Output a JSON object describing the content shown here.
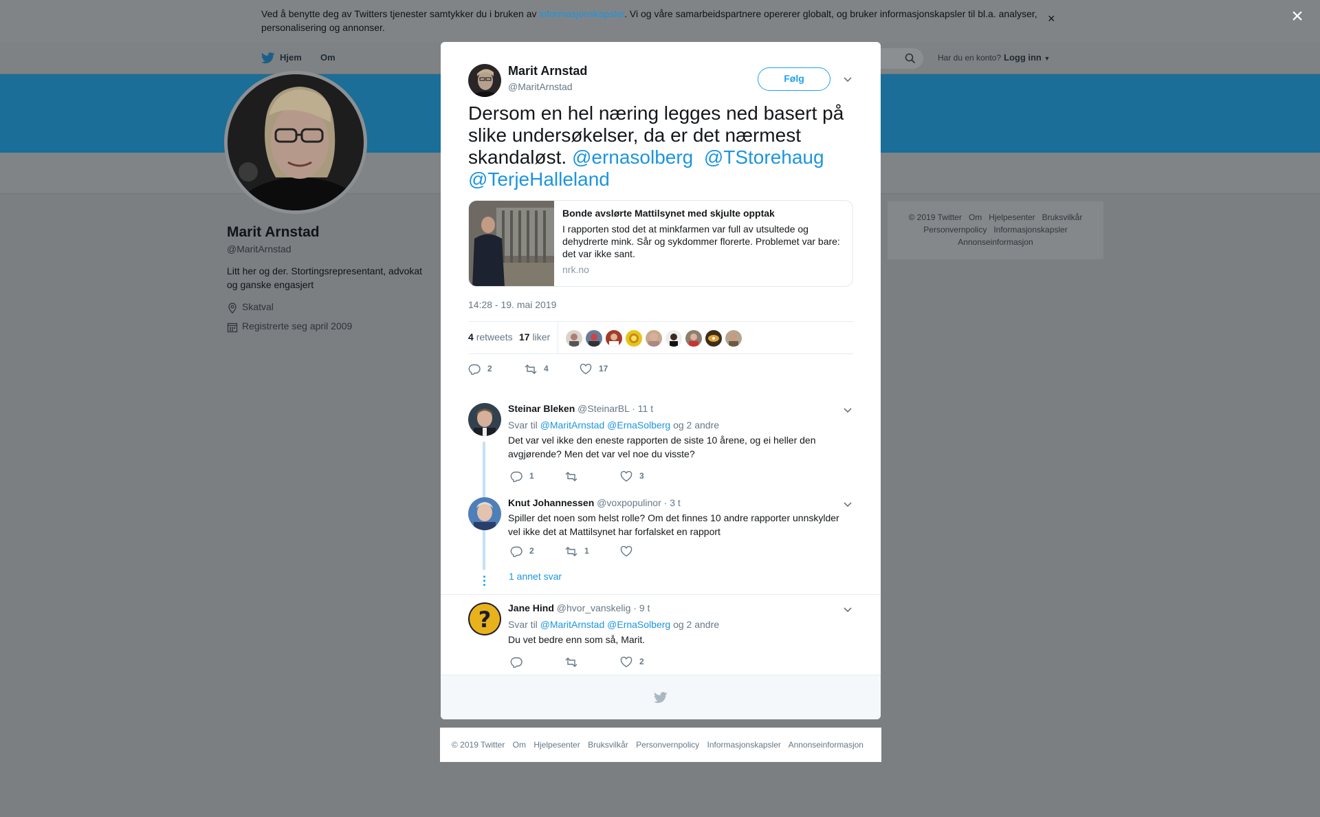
{
  "cookie": {
    "text_before": "Ved å benytte deg av Twitters tjenester samtykker du i bruken av ",
    "link": "informasjonskapsler",
    "text_after": ". Vi og våre samarbeidspartnere opererer globalt, og bruker informasjonskapsler til bl.a. analyser, personalisering og annonser.",
    "close_icon": "×"
  },
  "overlay_close_icon": "×",
  "nav": {
    "home": "Hjem",
    "about": "Om",
    "account_question": "Har du en konto?",
    "login": "Logg inn"
  },
  "profile": {
    "name": "Marit Arnstad",
    "handle": "@MaritArnstad",
    "bio": "Litt her og der. Stortingsrepresentant, advokat og ganske engasjert",
    "location": "Skatval",
    "joined": "Registrerte seg april 2009"
  },
  "side_footer": {
    "row1": [
      "© 2019 Twitter",
      "Om",
      "Hjelpesenter",
      "Bruksvilkår"
    ],
    "row2": [
      "Personvernpolicy",
      "Informasjonskapsler"
    ],
    "row3": [
      "Annonseinformasjon"
    ]
  },
  "tweet": {
    "author_name": "Marit Arnstad",
    "author_handle": "@MaritArnstad",
    "follow_label": "Følg",
    "text_line": "Dersom en hel næring legges ned basert på slike undersøkelser, da er det nærmest skandaløst. ",
    "mention1": "@ernasolberg",
    "mention2": "@TStorehaug",
    "mention3": "@TerjeHalleland",
    "card_title": "Bonde avslørte Mattilsynet med skjulte opptak",
    "card_desc": "I rapporten stod det at minkfarmen var full av utsultede og dehydrerte mink. Sår og sykdommer florerte. Problemet var bare: det var ikke sant.",
    "card_domain": "nrk.no",
    "time": "14:28 - 19. mai 2019",
    "retweets_count": "4",
    "retweets_label": "retweets",
    "likes_count": "17",
    "likes_label": "liker",
    "actions": {
      "replies": "2",
      "retweets": "4",
      "likes": "17"
    }
  },
  "replies": [
    {
      "name": "Steinar Bleken",
      "handle": "@SteinarBL",
      "time": "· 11 t",
      "reply_to_prefix": "Svar til",
      "reply_to_mentions": "@MaritArnstad @ErnaSolberg",
      "reply_to_suffix": "og 2 andre",
      "text": "Det var vel ikke den eneste rapporten de siste 10 årene, og ei heller den avgjørende? Men det var vel noe du visste?",
      "replies": "1",
      "retweets": "",
      "likes": "3"
    },
    {
      "name": "Knut Johannessen",
      "handle": "@voxpopulinor",
      "time": "· 3 t",
      "text": "Spiller det noen som helst rolle? Om det finnes 10 andre rapporter unnskylder vel ikke det at Mattilsynet har forfalsket en rapport",
      "replies": "2",
      "retweets": "1",
      "likes": ""
    },
    {
      "name": "Jane Hind",
      "handle": "@hvor_vanskelig",
      "time": "· 9 t",
      "reply_to_prefix": "Svar til",
      "reply_to_mentions": "@MaritArnstad @ErnaSolberg",
      "reply_to_suffix": "og 2 andre",
      "text": "Du vet bedre enn som så, Marit.",
      "replies": "",
      "retweets": "",
      "likes": "2"
    }
  ],
  "more_replies": "1 annet svar",
  "bottom_footer": [
    "© 2019 Twitter",
    "Om",
    "Hjelpesenter",
    "Bruksvilkår",
    "Personvernpolicy",
    "Informasjonskapsler",
    "Annonseinformasjon"
  ],
  "colors": {
    "link": "#1b95e0",
    "accent": "#1da1f2",
    "banner": "#1a6e98",
    "overlay": "#7c7f82"
  },
  "icons": [
    "close-icon",
    "twitter-bird-icon",
    "search-icon",
    "location-icon",
    "calendar-icon",
    "chevron-down-icon",
    "reply-icon",
    "retweet-icon",
    "like-icon"
  ]
}
